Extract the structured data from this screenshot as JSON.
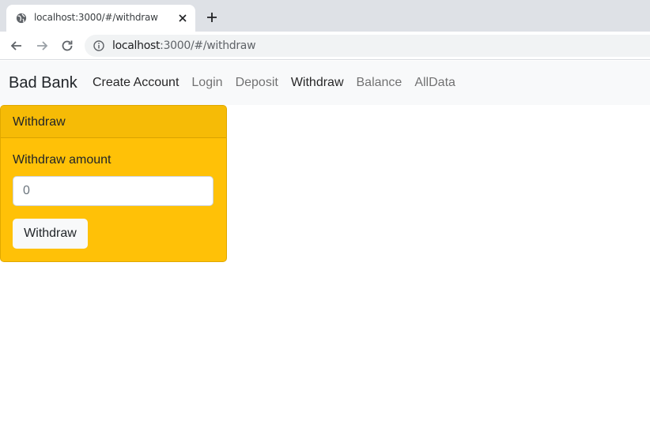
{
  "browser": {
    "tab_title": "localhost:3000/#/withdraw",
    "url_host": "localhost",
    "url_path": ":3000/#/withdraw",
    "icons": {
      "favicon": "globe-icon",
      "close": "close-icon",
      "new_tab": "plus-icon",
      "back": "back-arrow-icon",
      "forward": "forward-arrow-icon",
      "reload": "reload-icon",
      "site_info": "info-icon"
    }
  },
  "navbar": {
    "brand": "Bad Bank",
    "links": [
      {
        "label": "Create Account"
      },
      {
        "label": "Login"
      },
      {
        "label": "Deposit"
      },
      {
        "label": "Withdraw"
      },
      {
        "label": "Balance"
      },
      {
        "label": "AllData"
      }
    ]
  },
  "card": {
    "header": "Withdraw",
    "amount_label": "Withdraw amount",
    "amount_placeholder": "0",
    "submit_label": "Withdraw"
  },
  "colors": {
    "card_bg": "#ffc107",
    "navbar_bg": "#f8f9fa",
    "tabstrip_bg": "#dee1e6"
  }
}
